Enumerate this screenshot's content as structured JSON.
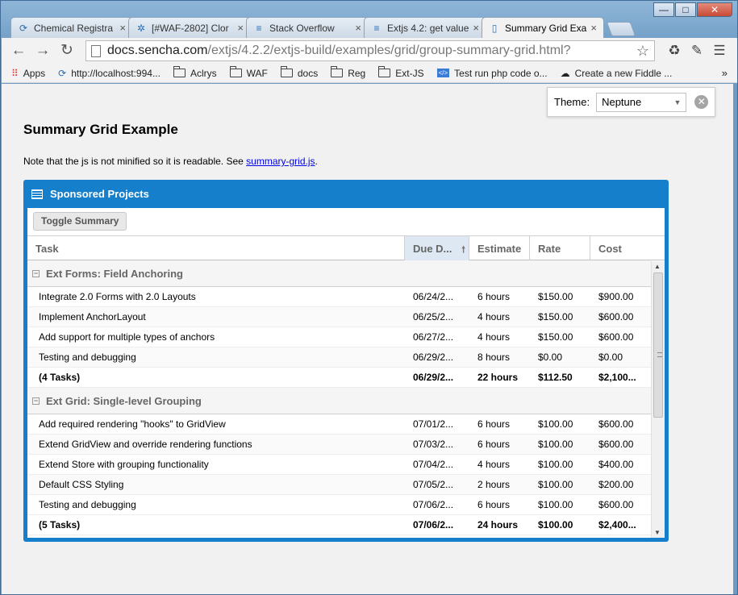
{
  "window": {
    "minimize": "—",
    "maximize": "□",
    "close": "✕"
  },
  "tabs": [
    {
      "label": "Chemical Registra",
      "icon": "sencha-icon"
    },
    {
      "label": "[#WAF-2802] Clor",
      "icon": "jira-icon"
    },
    {
      "label": "Stack Overflow",
      "icon": "stackoverflow-icon"
    },
    {
      "label": "Extjs 4.2: get value",
      "icon": "stackoverflow-icon"
    },
    {
      "label": "Summary Grid Exa",
      "icon": "page-icon",
      "active": true
    }
  ],
  "address": {
    "host": "docs.sencha.com",
    "path": "/extjs/4.2.2/extjs-build/examples/grid/group-summary-grid.html?"
  },
  "bookmarks": [
    {
      "label": "Apps",
      "icon": "apps-icon"
    },
    {
      "label": "http://localhost:994...",
      "icon": "sencha-icon"
    },
    {
      "label": "Aclrys",
      "icon": "folder-icon"
    },
    {
      "label": "WAF",
      "icon": "folder-icon"
    },
    {
      "label": "docs",
      "icon": "folder-icon"
    },
    {
      "label": "Reg",
      "icon": "folder-icon"
    },
    {
      "label": "Ext-JS",
      "icon": "folder-icon"
    },
    {
      "label": "Test run php code o...",
      "icon": "code-icon"
    },
    {
      "label": "Create a new Fiddle ...",
      "icon": "cloud-icon"
    }
  ],
  "bookmarks_more": "»",
  "theme": {
    "label": "Theme:",
    "value": "Neptune"
  },
  "page": {
    "title": "Summary Grid Example",
    "note_prefix": "Note that the js is not minified so it is readable. See ",
    "note_link": "summary-grid.js",
    "note_suffix": "."
  },
  "panel": {
    "title": "Sponsored Projects",
    "toggle_label": "Toggle Summary",
    "columns": {
      "task": "Task",
      "due": "Due D...",
      "estimate": "Estimate",
      "rate": "Rate",
      "cost": "Cost"
    },
    "groups": [
      {
        "name": "Ext Forms: Field Anchoring",
        "rows": [
          {
            "task": "Integrate 2.0 Forms with 2.0 Layouts",
            "due": "06/24/2...",
            "estimate": "6 hours",
            "rate": "$150.00",
            "cost": "$900.00"
          },
          {
            "task": "Implement AnchorLayout",
            "due": "06/25/2...",
            "estimate": "4 hours",
            "rate": "$150.00",
            "cost": "$600.00"
          },
          {
            "task": "Add support for multiple types of anchors",
            "due": "06/27/2...",
            "estimate": "4 hours",
            "rate": "$150.00",
            "cost": "$600.00"
          },
          {
            "task": "Testing and debugging",
            "due": "06/29/2...",
            "estimate": "8 hours",
            "rate": "$0.00",
            "cost": "$0.00"
          }
        ],
        "summary": {
          "task": "(4 Tasks)",
          "due": "06/29/2...",
          "estimate": "22 hours",
          "rate": "$112.50",
          "cost": "$2,100..."
        }
      },
      {
        "name": "Ext Grid: Single-level Grouping",
        "rows": [
          {
            "task": "Add required rendering \"hooks\" to GridView",
            "due": "07/01/2...",
            "estimate": "6 hours",
            "rate": "$100.00",
            "cost": "$600.00"
          },
          {
            "task": "Extend GridView and override rendering functions",
            "due": "07/03/2...",
            "estimate": "6 hours",
            "rate": "$100.00",
            "cost": "$600.00"
          },
          {
            "task": "Extend Store with grouping functionality",
            "due": "07/04/2...",
            "estimate": "4 hours",
            "rate": "$100.00",
            "cost": "$400.00"
          },
          {
            "task": "Default CSS Styling",
            "due": "07/05/2...",
            "estimate": "2 hours",
            "rate": "$100.00",
            "cost": "$200.00"
          },
          {
            "task": "Testing and debugging",
            "due": "07/06/2...",
            "estimate": "6 hours",
            "rate": "$100.00",
            "cost": "$600.00"
          }
        ],
        "summary": {
          "task": "(5 Tasks)",
          "due": "07/06/2...",
          "estimate": "24 hours",
          "rate": "$100.00",
          "cost": "$2,400..."
        }
      }
    ]
  }
}
